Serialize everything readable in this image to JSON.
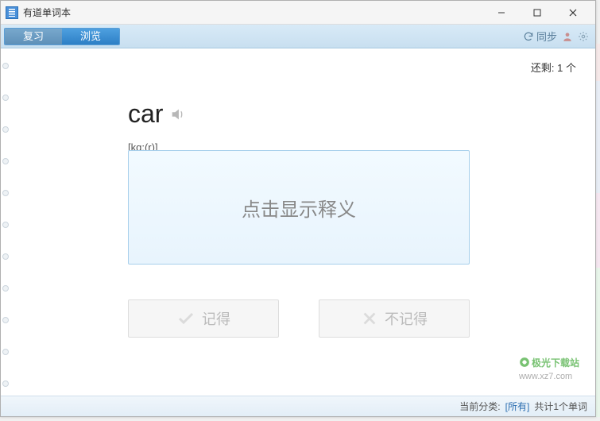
{
  "titlebar": {
    "title": "有道单词本"
  },
  "toolbar": {
    "tab_review": "复习",
    "tab_browse": "浏览",
    "sync_label": "同步"
  },
  "content": {
    "remaining_label": "还剩:",
    "remaining_count": "1 个",
    "word": "car",
    "phonetic": "[kɑ:(r)]",
    "show_def_label": "点击显示释义",
    "btn_remember": "记得",
    "btn_forget": "不记得"
  },
  "statusbar": {
    "category_label": "当前分类:",
    "category_value": "[所有]",
    "total_label": "共计1个单词"
  },
  "watermark": {
    "brand": "极光下载站",
    "url": "www.xz7.com"
  }
}
